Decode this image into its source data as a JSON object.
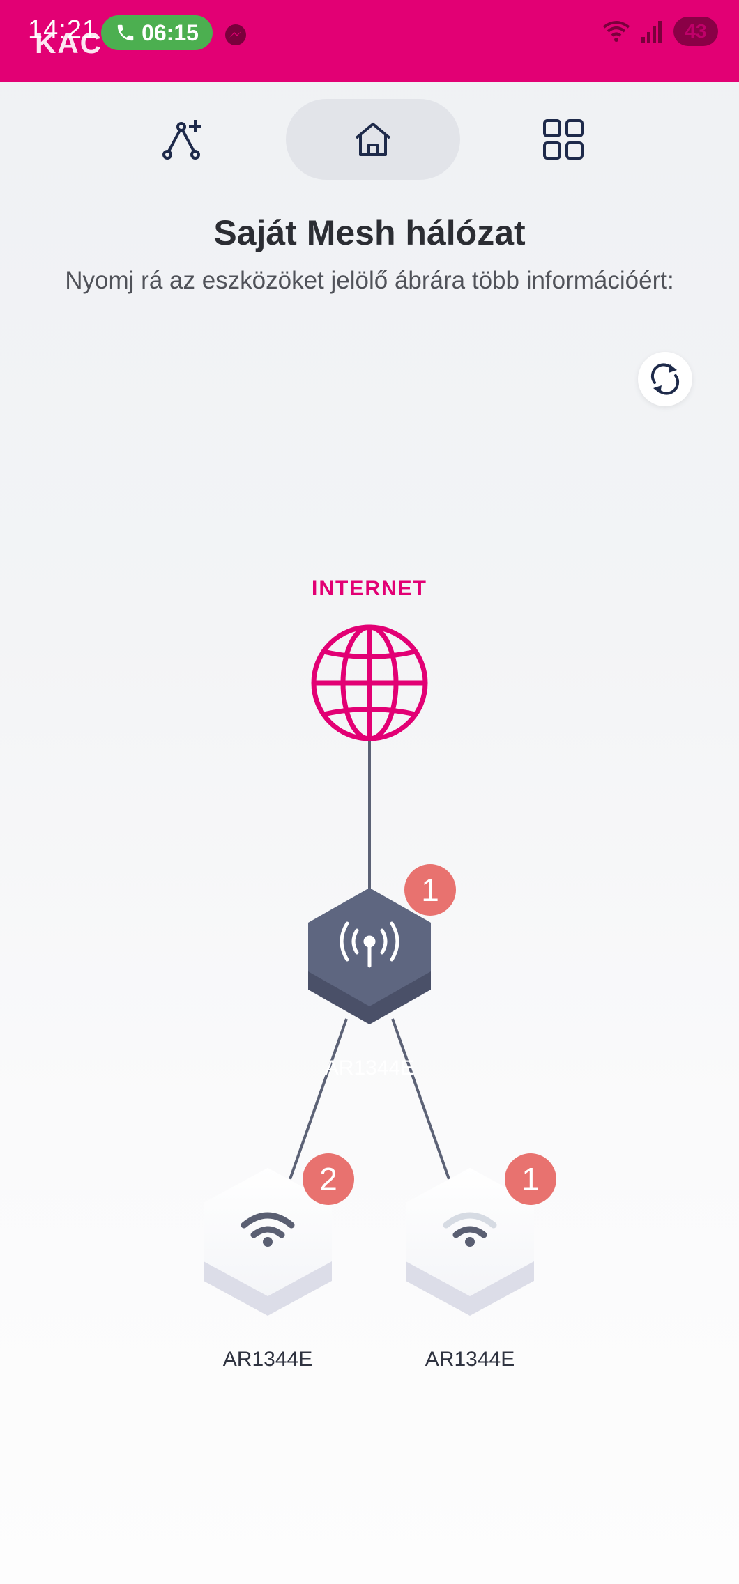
{
  "status_bar": {
    "time": "14:21",
    "app_name": "KAC",
    "call_timer": "06:15",
    "battery": "43",
    "icons": [
      "phone-icon",
      "messenger-icon",
      "wifi-icon",
      "signal-icon"
    ]
  },
  "nav": {
    "icons": [
      "add-node-icon",
      "home-icon",
      "grid-icon"
    ],
    "active": "home"
  },
  "header": {
    "title": "Saját Mesh hálózat",
    "subtitle": "Nyomj rá az eszközöket jelölő ábrára több információért:"
  },
  "topology": {
    "internet_label": "INTERNET",
    "router": {
      "label": "AR1344E",
      "badge": "1"
    },
    "satellites": [
      {
        "label": "AR1344E",
        "badge": "2"
      },
      {
        "label": "AR1344E",
        "badge": "1"
      }
    ]
  },
  "colors": {
    "brand": "#e20074",
    "router": "#5e6680",
    "badge": "#e8726f",
    "call": "#4caf50"
  }
}
